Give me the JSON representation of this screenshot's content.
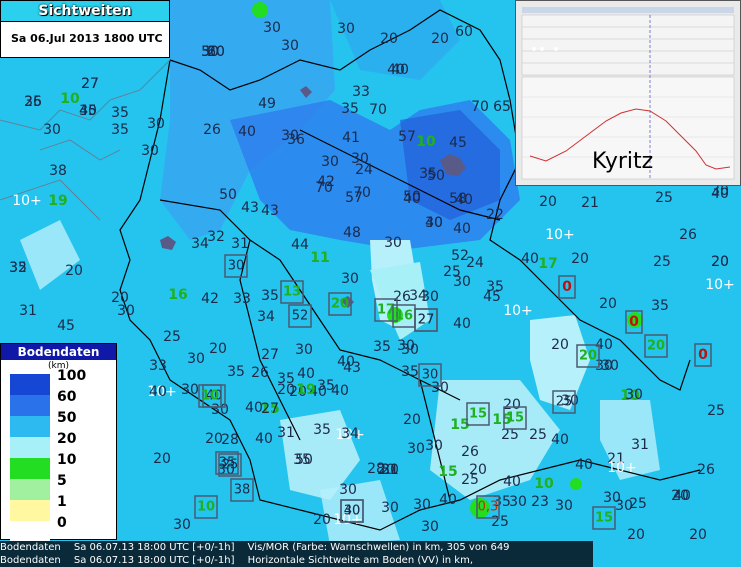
{
  "header": {
    "title": "Sichtweiten",
    "date": "Sa 06.Jul 2013 1800 UTC"
  },
  "meteogram": {
    "label": "Kyritz"
  },
  "legend": {
    "title": "Bodendaten",
    "unit": "(km)",
    "entries": [
      {
        "label": "100",
        "color": "#1646d4"
      },
      {
        "label": "60",
        "color": "#2a72ea"
      },
      {
        "label": "50",
        "color": "#2cbaf0"
      },
      {
        "label": "20",
        "color": "#a8f0f8"
      },
      {
        "label": "10",
        "color": "#22dd22"
      },
      {
        "label": "5",
        "color": "#a0f0a0"
      },
      {
        "label": "1",
        "color": "#fff8a0"
      },
      {
        "label": "0",
        "color": "#ffffff"
      }
    ]
  },
  "status_bar": [
    {
      "source": "Bodendaten",
      "time": "Sa 06.07.13 18:00 UTC [+0/-1h]",
      "desc": "Vis/MOR (Farbe: Warnschwellen) in km, 305 von 649"
    },
    {
      "source": "Bodendaten",
      "time": "Sa 06.07.13 18:00 UTC [+0/-1h]",
      "desc": "Horizontale Sichtweite am Boden (VV) in km,"
    }
  ],
  "stations": {
    "plain": [
      "30",
      "50",
      "60",
      "35",
      "45",
      "20",
      "20",
      "30",
      "40",
      "27",
      "45",
      "35",
      "10",
      "30",
      "35",
      "30",
      "30",
      "26",
      "30",
      "49",
      "40",
      "30",
      "33",
      "70",
      "60",
      "70",
      "65",
      "35",
      "30",
      "30",
      "30",
      "40",
      "36",
      "41",
      "42",
      "57",
      "70",
      "40",
      "10",
      "45",
      "40",
      "27",
      "38",
      "24",
      "50",
      "20",
      "19",
      "10+",
      "50",
      "43",
      "70",
      "57",
      "50",
      "58",
      "40",
      "30",
      "40",
      "20",
      "21",
      "30",
      "43",
      "48",
      "35",
      "22",
      "25",
      "26",
      "40",
      "34",
      "31",
      "32",
      "44",
      "11",
      "30",
      "52",
      "24",
      "17",
      "10+",
      "30",
      "35",
      "20",
      "40",
      "30",
      "20",
      "25",
      "32",
      "20",
      "16",
      "42",
      "26",
      "30",
      "33",
      "35",
      "25",
      "34",
      "35",
      "45",
      "30",
      "20",
      "20",
      "10+",
      "20",
      "35",
      "40",
      "30",
      "31",
      "45",
      "25",
      "40",
      "35",
      "30",
      "10+",
      "20",
      "40",
      "33",
      "30",
      "34",
      "27",
      "30",
      "35",
      "20",
      "40",
      "40",
      "10+",
      "30",
      "35",
      "20",
      "30",
      "26",
      "40",
      "43",
      "15",
      "30",
      "35",
      "30",
      "20",
      "30",
      "30",
      "10",
      "30",
      "25",
      "40",
      "35",
      "28",
      "40",
      "20",
      "19",
      "35",
      "25",
      "40",
      "25",
      "30",
      "15",
      "35",
      "10+",
      "20",
      "20",
      "30",
      "40",
      "31",
      "27",
      "50",
      "34",
      "20",
      "20",
      "30",
      "15",
      "20",
      "10",
      "40",
      "21",
      "31",
      "26",
      "30",
      "28",
      "30",
      "30",
      "15",
      "40",
      "26",
      "40",
      "35",
      "25",
      "21",
      "23",
      "30",
      "30",
      "20",
      "30",
      "20",
      "10+",
      "30",
      "30",
      "25",
      "30",
      "40",
      "25",
      "10+",
      "30",
      "20",
      "20",
      "15",
      "30",
      "20",
      "26",
      "30"
    ],
    "boxed": [
      "30",
      "13",
      "20",
      "52",
      "17",
      "16",
      "27",
      "30",
      "15",
      "25",
      "15",
      "40",
      "10",
      "25",
      "20",
      "20",
      "27",
      "35",
      "38",
      "10",
      "30",
      "0,3",
      "15",
      "40"
    ],
    "warning": [
      "0",
      "0",
      "0"
    ]
  }
}
